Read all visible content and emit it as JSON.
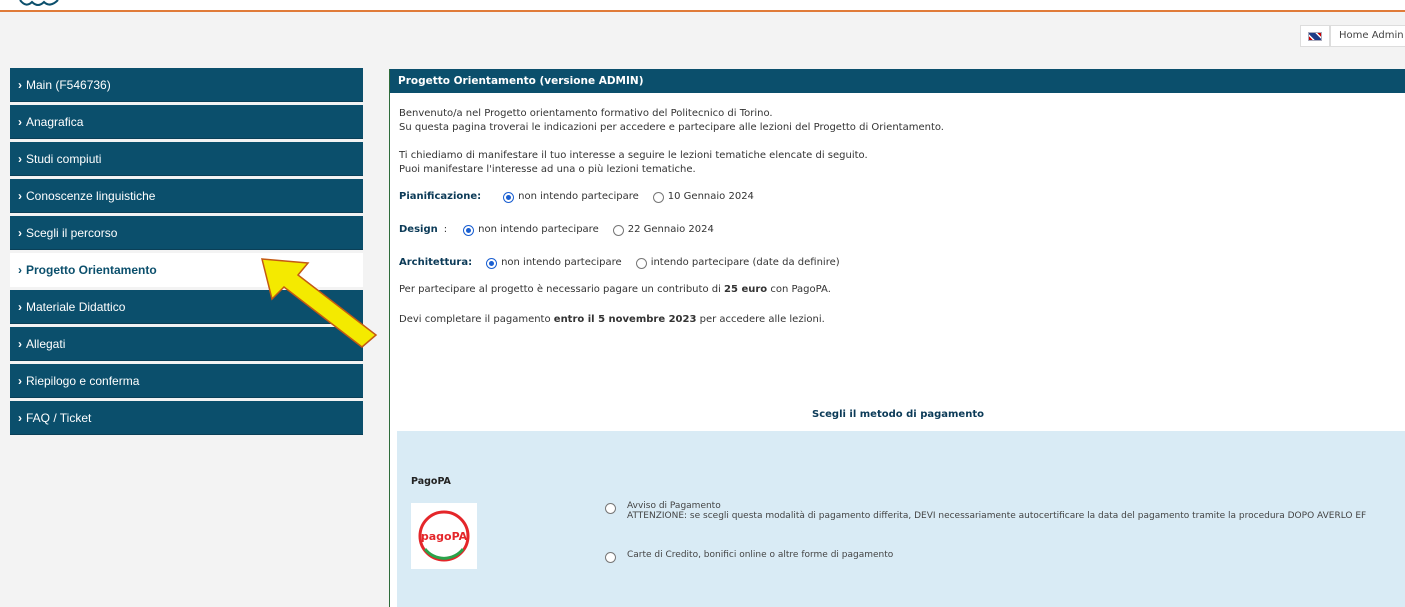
{
  "header": {
    "home_label": "Home Admin",
    "flag_icon": "uk-flag-icon"
  },
  "sidebar": {
    "items": [
      {
        "label": "Main (F546736)",
        "active": false
      },
      {
        "label": "Anagrafica",
        "active": false
      },
      {
        "label": "Studi compiuti",
        "active": false
      },
      {
        "label": "Conoscenze linguistiche",
        "active": false
      },
      {
        "label": "Scegli il percorso",
        "active": false
      },
      {
        "label": "Progetto Orientamento",
        "active": true
      },
      {
        "label": "Materiale Didattico",
        "active": false
      },
      {
        "label": "Allegati",
        "active": false
      },
      {
        "label": "Riepilogo e conferma",
        "active": false
      },
      {
        "label": "FAQ / Ticket",
        "active": false
      }
    ]
  },
  "panel": {
    "title": "Progetto Orientamento (versione ADMIN)",
    "intro_1": "Benvenuto/a nel Progetto orientamento formativo del Politecnico di Torino.",
    "intro_2": "Su questa pagina troverai le indicazioni per accedere e partecipare alle lezioni del Progetto di Orientamento.",
    "interest_1": "Ti chiediamo di manifestare il tuo interesse a seguire le lezioni tematiche elencate di seguito.",
    "interest_2": "Puoi manifestare l'interesse ad una o più lezioni tematiche.",
    "lessons": [
      {
        "label": "Pianificazione:",
        "opt_no": "non intendo partecipare",
        "opt_yes": "10 Gennaio 2024",
        "selected": "no"
      },
      {
        "label": "Design",
        "opt_no": "non intendo partecipare",
        "opt_yes": "22 Gennaio 2024",
        "selected": "no"
      },
      {
        "label": "Architettura:",
        "opt_no": "non intendo partecipare",
        "opt_yes": "intendo partecipare (date da definire)",
        "selected": "no"
      }
    ],
    "fee_pre": "Per partecipare al progetto è necessario pagare un contributo di ",
    "fee_bold": "25 euro",
    "fee_post": " con PagoPA.",
    "deadline_pre": "Devi completare il pagamento ",
    "deadline_bold": "entro il 5 novembre 2023",
    "deadline_post": " per accedere alle lezioni."
  },
  "payment": {
    "title": "Scegli il metodo di pagamento",
    "method_label": "PagoPA",
    "logo_text": "pagoPA",
    "options": [
      {
        "label": "Avviso di Pagamento",
        "note": "ATTENZIONE: se scegli questa modalità di pagamento differita, DEVI necessariamente autocertificare la data del pagamento tramite la procedura DOPO AVERLO EF"
      },
      {
        "label": "Carte di Credito, bonifici online o altre forme di pagamento",
        "note": ""
      }
    ]
  },
  "colors": {
    "sidebar_bg": "#0b4f6c",
    "accent_orange": "#e07b39",
    "arrow_yellow": "#f4ea00",
    "payment_bg": "#d9ebf5"
  }
}
